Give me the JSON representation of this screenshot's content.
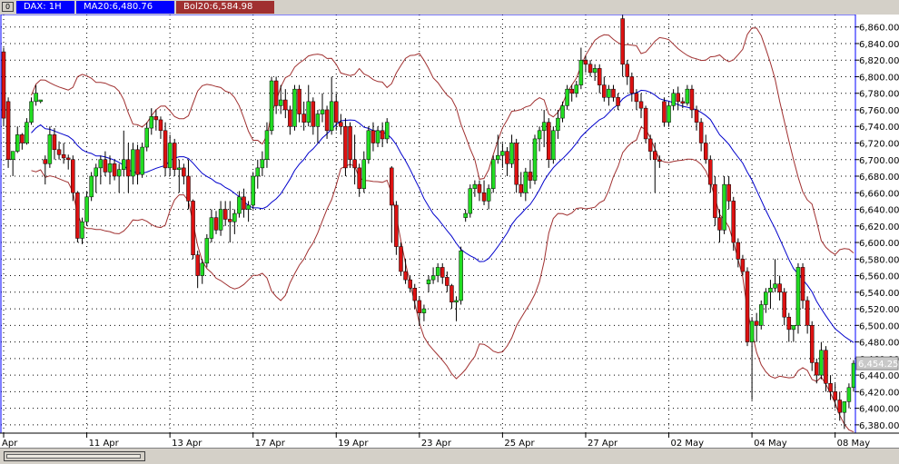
{
  "header": {
    "symbol_label": "DAX: 1H",
    "ma_label": "MA20:6,480.76",
    "bol_label": "Bol20:6,584.98"
  },
  "colors": {
    "up_candle": "#22dd22",
    "down_candle": "#dd1111",
    "ma_line": "#0000cc",
    "bollinger": "#a03030",
    "grid": "#000000",
    "last_price_box": "#c8c8c8"
  },
  "chart_data": {
    "type": "candlestick",
    "symbol": "DAX",
    "timeframe": "1H",
    "ylim": [
      6370,
      6875
    ],
    "y_ticks": [
      6380,
      6400,
      6420,
      6440,
      6460,
      6480,
      6500,
      6520,
      6540,
      6560,
      6580,
      6600,
      6620,
      6640,
      6660,
      6680,
      6700,
      6720,
      6740,
      6760,
      6780,
      6800,
      6820,
      6840,
      6860
    ],
    "y_tick_labels": [
      "6,380.00",
      "6,400.00",
      "6,420.00",
      "6,440.00",
      "6,460.00",
      "6,480.00",
      "6,500.00",
      "6,520.00",
      "6,540.00",
      "6,560.00",
      "6,580.00",
      "6,600.00",
      "6,620.00",
      "6,640.00",
      "6,660.00",
      "6,680.00",
      "6,700.00",
      "6,720.00",
      "6,740.00",
      "6,760.00",
      "6,780.00",
      "6,800.00",
      "6,820.00",
      "6,840.00",
      "6,860.00"
    ],
    "x_tick_labels": [
      "Apr",
      "11 Apr",
      "13 Apr",
      "17 Apr",
      "19 Apr",
      "23 Apr",
      "25 Apr",
      "27 Apr",
      "02 May",
      "04 May",
      "08 May"
    ],
    "x_tick_index": [
      0,
      18,
      36,
      54,
      72,
      90,
      108,
      126,
      144,
      162,
      180
    ],
    "last_price": 6454.25,
    "last_price_label": "6,454.25",
    "grid": true,
    "candles": [
      {
        "o": 6830,
        "h": 6835,
        "l": 6740,
        "c": 6750
      },
      {
        "o": 6770,
        "h": 6775,
        "l": 6690,
        "c": 6700
      },
      {
        "o": 6700,
        "h": 6705,
        "l": 6680,
        "c": 6710
      },
      {
        "o": 6710,
        "h": 6740,
        "l": 6708,
        "c": 6730
      },
      {
        "o": 6730,
        "h": 6732,
        "l": 6712,
        "c": 6720
      },
      {
        "o": 6720,
        "h": 6750,
        "l": 6718,
        "c": 6745
      },
      {
        "o": 6745,
        "h": 6775,
        "l": 6742,
        "c": 6770
      },
      {
        "o": 6770,
        "h": 6790,
        "l": 6765,
        "c": 6780
      },
      {
        "o": 6770,
        "h": 6772,
        "l": 6768,
        "c": 6772
      },
      {
        "o": 6700,
        "h": 6705,
        "l": 6670,
        "c": 6695
      },
      {
        "o": 6695,
        "h": 6740,
        "l": 6690,
        "c": 6730
      },
      {
        "o": 6730,
        "h": 6738,
        "l": 6700,
        "c": 6712
      },
      {
        "o": 6712,
        "h": 6722,
        "l": 6700,
        "c": 6706
      },
      {
        "o": 6706,
        "h": 6720,
        "l": 6695,
        "c": 6702
      },
      {
        "o": 6702,
        "h": 6706,
        "l": 6688,
        "c": 6700
      },
      {
        "o": 6700,
        "h": 6705,
        "l": 6650,
        "c": 6660
      },
      {
        "o": 6660,
        "h": 6662,
        "l": 6600,
        "c": 6605
      },
      {
        "o": 6605,
        "h": 6630,
        "l": 6598,
        "c": 6625
      },
      {
        "o": 6625,
        "h": 6662,
        "l": 6620,
        "c": 6655
      },
      {
        "o": 6655,
        "h": 6685,
        "l": 6650,
        "c": 6680
      },
      {
        "o": 6680,
        "h": 6695,
        "l": 6660,
        "c": 6690
      },
      {
        "o": 6690,
        "h": 6705,
        "l": 6670,
        "c": 6700
      },
      {
        "o": 6700,
        "h": 6710,
        "l": 6680,
        "c": 6685
      },
      {
        "o": 6685,
        "h": 6705,
        "l": 6670,
        "c": 6695
      },
      {
        "o": 6695,
        "h": 6700,
        "l": 6675,
        "c": 6680
      },
      {
        "o": 6680,
        "h": 6695,
        "l": 6660,
        "c": 6688
      },
      {
        "o": 6688,
        "h": 6735,
        "l": 6680,
        "c": 6700
      },
      {
        "o": 6700,
        "h": 6720,
        "l": 6660,
        "c": 6680
      },
      {
        "o": 6680,
        "h": 6720,
        "l": 6670,
        "c": 6712
      },
      {
        "o": 6712,
        "h": 6718,
        "l": 6670,
        "c": 6682
      },
      {
        "o": 6682,
        "h": 6720,
        "l": 6678,
        "c": 6715
      },
      {
        "o": 6715,
        "h": 6745,
        "l": 6710,
        "c": 6738
      },
      {
        "o": 6738,
        "h": 6762,
        "l": 6730,
        "c": 6752
      },
      {
        "o": 6752,
        "h": 6760,
        "l": 6735,
        "c": 6748
      },
      {
        "o": 6748,
        "h": 6752,
        "l": 6725,
        "c": 6735
      },
      {
        "o": 6735,
        "h": 6745,
        "l": 6680,
        "c": 6690
      },
      {
        "o": 6690,
        "h": 6730,
        "l": 6680,
        "c": 6720
      },
      {
        "o": 6720,
        "h": 6725,
        "l": 6680,
        "c": 6688
      },
      {
        "o": 6688,
        "h": 6700,
        "l": 6660,
        "c": 6690
      },
      {
        "o": 6690,
        "h": 6695,
        "l": 6670,
        "c": 6680
      },
      {
        "o": 6680,
        "h": 6700,
        "l": 6640,
        "c": 6650
      },
      {
        "o": 6650,
        "h": 6652,
        "l": 6580,
        "c": 6585
      },
      {
        "o": 6585,
        "h": 6590,
        "l": 6545,
        "c": 6560
      },
      {
        "o": 6560,
        "h": 6580,
        "l": 6550,
        "c": 6575
      },
      {
        "o": 6575,
        "h": 6610,
        "l": 6570,
        "c": 6605
      },
      {
        "o": 6605,
        "h": 6640,
        "l": 6600,
        "c": 6630
      },
      {
        "o": 6630,
        "h": 6638,
        "l": 6610,
        "c": 6615
      },
      {
        "o": 6615,
        "h": 6650,
        "l": 6608,
        "c": 6640
      },
      {
        "o": 6640,
        "h": 6650,
        "l": 6620,
        "c": 6628
      },
      {
        "o": 6628,
        "h": 6650,
        "l": 6600,
        "c": 6625
      },
      {
        "o": 6625,
        "h": 6640,
        "l": 6610,
        "c": 6635
      },
      {
        "o": 6635,
        "h": 6662,
        "l": 6630,
        "c": 6655
      },
      {
        "o": 6655,
        "h": 6665,
        "l": 6630,
        "c": 6640
      },
      {
        "o": 6640,
        "h": 6650,
        "l": 6625,
        "c": 6645
      },
      {
        "o": 6645,
        "h": 6685,
        "l": 6640,
        "c": 6680
      },
      {
        "o": 6680,
        "h": 6700,
        "l": 6665,
        "c": 6690
      },
      {
        "o": 6690,
        "h": 6710,
        "l": 6680,
        "c": 6700
      },
      {
        "o": 6700,
        "h": 6745,
        "l": 6690,
        "c": 6735
      },
      {
        "o": 6735,
        "h": 6800,
        "l": 6730,
        "c": 6795
      },
      {
        "o": 6795,
        "h": 6800,
        "l": 6755,
        "c": 6765
      },
      {
        "o": 6765,
        "h": 6790,
        "l": 6755,
        "c": 6772
      },
      {
        "o": 6772,
        "h": 6785,
        "l": 6750,
        "c": 6760
      },
      {
        "o": 6760,
        "h": 6765,
        "l": 6730,
        "c": 6740
      },
      {
        "o": 6740,
        "h": 6790,
        "l": 6735,
        "c": 6785
      },
      {
        "o": 6785,
        "h": 6790,
        "l": 6745,
        "c": 6755
      },
      {
        "o": 6755,
        "h": 6770,
        "l": 6735,
        "c": 6745
      },
      {
        "o": 6745,
        "h": 6790,
        "l": 6740,
        "c": 6770
      },
      {
        "o": 6770,
        "h": 6775,
        "l": 6730,
        "c": 6740
      },
      {
        "o": 6740,
        "h": 6760,
        "l": 6720,
        "c": 6755
      },
      {
        "o": 6755,
        "h": 6780,
        "l": 6745,
        "c": 6760
      },
      {
        "o": 6760,
        "h": 6765,
        "l": 6725,
        "c": 6735
      },
      {
        "o": 6735,
        "h": 6800,
        "l": 6730,
        "c": 6770
      },
      {
        "o": 6770,
        "h": 6780,
        "l": 6735,
        "c": 6745
      },
      {
        "o": 6745,
        "h": 6755,
        "l": 6730,
        "c": 6740
      },
      {
        "o": 6740,
        "h": 6750,
        "l": 6680,
        "c": 6690
      },
      {
        "o": 6740,
        "h": 6745,
        "l": 6690,
        "c": 6700
      },
      {
        "o": 6700,
        "h": 6730,
        "l": 6670,
        "c": 6690
      },
      {
        "o": 6690,
        "h": 6695,
        "l": 6655,
        "c": 6665
      },
      {
        "o": 6665,
        "h": 6710,
        "l": 6660,
        "c": 6700
      },
      {
        "o": 6700,
        "h": 6740,
        "l": 6695,
        "c": 6735
      },
      {
        "o": 6735,
        "h": 6745,
        "l": 6710,
        "c": 6720
      },
      {
        "o": 6720,
        "h": 6740,
        "l": 6715,
        "c": 6735
      },
      {
        "o": 6735,
        "h": 6745,
        "l": 6715,
        "c": 6725
      },
      {
        "o": 6725,
        "h": 6750,
        "l": 6720,
        "c": 6745
      },
      {
        "o": 6690,
        "h": 6692,
        "l": 6600,
        "c": 6645
      },
      {
        "o": 6645,
        "h": 6650,
        "l": 6585,
        "c": 6595
      },
      {
        "o": 6595,
        "h": 6600,
        "l": 6560,
        "c": 6565
      },
      {
        "o": 6565,
        "h": 6580,
        "l": 6550,
        "c": 6555
      },
      {
        "o": 6555,
        "h": 6560,
        "l": 6540,
        "c": 6545
      },
      {
        "o": 6545,
        "h": 6550,
        "l": 6520,
        "c": 6530
      },
      {
        "o": 6530,
        "h": 6535,
        "l": 6500,
        "c": 6515
      },
      {
        "o": 6515,
        "h": 6525,
        "l": 6505,
        "c": 6520
      },
      {
        "o": 6550,
        "h": 6560,
        "l": 6540,
        "c": 6555
      },
      {
        "o": 6555,
        "h": 6570,
        "l": 6550,
        "c": 6560
      },
      {
        "o": 6560,
        "h": 6575,
        "l": 6552,
        "c": 6570
      },
      {
        "o": 6570,
        "h": 6575,
        "l": 6550,
        "c": 6558
      },
      {
        "o": 6558,
        "h": 6565,
        "l": 6540,
        "c": 6548
      },
      {
        "o": 6548,
        "h": 6550,
        "l": 6520,
        "c": 6528
      },
      {
        "o": 6528,
        "h": 6535,
        "l": 6505,
        "c": 6530
      },
      {
        "o": 6530,
        "h": 6595,
        "l": 6525,
        "c": 6590
      },
      {
        "o": 6630,
        "h": 6640,
        "l": 6625,
        "c": 6635
      },
      {
        "o": 6635,
        "h": 6670,
        "l": 6630,
        "c": 6665
      },
      {
        "o": 6665,
        "h": 6675,
        "l": 6655,
        "c": 6670
      },
      {
        "o": 6670,
        "h": 6675,
        "l": 6650,
        "c": 6660
      },
      {
        "o": 6660,
        "h": 6675,
        "l": 6645,
        "c": 6650
      },
      {
        "o": 6650,
        "h": 6670,
        "l": 6640,
        "c": 6665
      },
      {
        "o": 6665,
        "h": 6705,
        "l": 6660,
        "c": 6700
      },
      {
        "o": 6700,
        "h": 6730,
        "l": 6695,
        "c": 6705
      },
      {
        "o": 6705,
        "h": 6720,
        "l": 6690,
        "c": 6710
      },
      {
        "o": 6710,
        "h": 6715,
        "l": 6680,
        "c": 6695
      },
      {
        "o": 6695,
        "h": 6730,
        "l": 6690,
        "c": 6720
      },
      {
        "o": 6720,
        "h": 6725,
        "l": 6660,
        "c": 6670
      },
      {
        "o": 6670,
        "h": 6685,
        "l": 6655,
        "c": 6660
      },
      {
        "o": 6660,
        "h": 6690,
        "l": 6650,
        "c": 6685
      },
      {
        "o": 6685,
        "h": 6700,
        "l": 6665,
        "c": 6675
      },
      {
        "o": 6675,
        "h": 6730,
        "l": 6670,
        "c": 6725
      },
      {
        "o": 6725,
        "h": 6740,
        "l": 6710,
        "c": 6735
      },
      {
        "o": 6735,
        "h": 6760,
        "l": 6715,
        "c": 6745
      },
      {
        "o": 6745,
        "h": 6750,
        "l": 6690,
        "c": 6700
      },
      {
        "o": 6700,
        "h": 6740,
        "l": 6695,
        "c": 6735
      },
      {
        "o": 6735,
        "h": 6760,
        "l": 6725,
        "c": 6750
      },
      {
        "o": 6750,
        "h": 6770,
        "l": 6745,
        "c": 6765
      },
      {
        "o": 6765,
        "h": 6790,
        "l": 6760,
        "c": 6785
      },
      {
        "o": 6785,
        "h": 6790,
        "l": 6770,
        "c": 6780
      },
      {
        "o": 6780,
        "h": 6795,
        "l": 6775,
        "c": 6790
      },
      {
        "o": 6790,
        "h": 6835,
        "l": 6785,
        "c": 6820
      },
      {
        "o": 6820,
        "h": 6825,
        "l": 6805,
        "c": 6815
      },
      {
        "o": 6815,
        "h": 6820,
        "l": 6800,
        "c": 6805
      },
      {
        "o": 6805,
        "h": 6815,
        "l": 6795,
        "c": 6810
      },
      {
        "o": 6810,
        "h": 6815,
        "l": 6780,
        "c": 6790
      },
      {
        "o": 6790,
        "h": 6800,
        "l": 6770,
        "c": 6775
      },
      {
        "o": 6775,
        "h": 6790,
        "l": 6765,
        "c": 6785
      },
      {
        "o": 6785,
        "h": 6790,
        "l": 6770,
        "c": 6775
      },
      {
        "o": 6775,
        "h": 6780,
        "l": 6760,
        "c": 6765
      },
      {
        "o": 6870,
        "h": 6880,
        "l": 6800,
        "c": 6815
      },
      {
        "o": 6815,
        "h": 6820,
        "l": 6790,
        "c": 6800
      },
      {
        "o": 6800,
        "h": 6805,
        "l": 6770,
        "c": 6780
      },
      {
        "o": 6780,
        "h": 6785,
        "l": 6760,
        "c": 6770
      },
      {
        "o": 6770,
        "h": 6780,
        "l": 6750,
        "c": 6762
      },
      {
        "o": 6762,
        "h": 6765,
        "l": 6720,
        "c": 6725
      },
      {
        "o": 6725,
        "h": 6730,
        "l": 6700,
        "c": 6710
      },
      {
        "o": 6710,
        "h": 6720,
        "l": 6660,
        "c": 6700
      },
      {
        "o": 6700,
        "h": 6705,
        "l": 6690,
        "c": 6698
      },
      {
        "o": 6770,
        "h": 6775,
        "l": 6740,
        "c": 6745
      },
      {
        "o": 6745,
        "h": 6770,
        "l": 6740,
        "c": 6765
      },
      {
        "o": 6765,
        "h": 6785,
        "l": 6760,
        "c": 6780
      },
      {
        "o": 6780,
        "h": 6788,
        "l": 6760,
        "c": 6770
      },
      {
        "o": 6770,
        "h": 6775,
        "l": 6762,
        "c": 6768
      },
      {
        "o": 6768,
        "h": 6790,
        "l": 6765,
        "c": 6785
      },
      {
        "o": 6785,
        "h": 6790,
        "l": 6750,
        "c": 6760
      },
      {
        "o": 6760,
        "h": 6765,
        "l": 6735,
        "c": 6745
      },
      {
        "o": 6745,
        "h": 6750,
        "l": 6710,
        "c": 6720
      },
      {
        "o": 6720,
        "h": 6730,
        "l": 6695,
        "c": 6700
      },
      {
        "o": 6700,
        "h": 6705,
        "l": 6660,
        "c": 6670
      },
      {
        "o": 6670,
        "h": 6680,
        "l": 6620,
        "c": 6630
      },
      {
        "o": 6630,
        "h": 6640,
        "l": 6600,
        "c": 6615
      },
      {
        "o": 6615,
        "h": 6680,
        "l": 6610,
        "c": 6670
      },
      {
        "o": 6670,
        "h": 6680,
        "l": 6640,
        "c": 6650
      },
      {
        "o": 6650,
        "h": 6655,
        "l": 6590,
        "c": 6600
      },
      {
        "o": 6600,
        "h": 6605,
        "l": 6570,
        "c": 6580
      },
      {
        "o": 6580,
        "h": 6585,
        "l": 6560,
        "c": 6565
      },
      {
        "o": 6565,
        "h": 6570,
        "l": 6475,
        "c": 6480
      },
      {
        "o": 6480,
        "h": 6510,
        "l": 6410,
        "c": 6505
      },
      {
        "o": 6505,
        "h": 6515,
        "l": 6480,
        "c": 6500
      },
      {
        "o": 6500,
        "h": 6530,
        "l": 6495,
        "c": 6525
      },
      {
        "o": 6525,
        "h": 6545,
        "l": 6515,
        "c": 6540
      },
      {
        "o": 6540,
        "h": 6555,
        "l": 6520,
        "c": 6545
      },
      {
        "o": 6545,
        "h": 6580,
        "l": 6540,
        "c": 6550
      },
      {
        "o": 6550,
        "h": 6560,
        "l": 6530,
        "c": 6540
      },
      {
        "o": 6540,
        "h": 6545,
        "l": 6500,
        "c": 6510
      },
      {
        "o": 6510,
        "h": 6515,
        "l": 6480,
        "c": 6495
      },
      {
        "o": 6495,
        "h": 6500,
        "l": 6480,
        "c": 6500
      },
      {
        "o": 6500,
        "h": 6575,
        "l": 6490,
        "c": 6570
      },
      {
        "o": 6570,
        "h": 6575,
        "l": 6520,
        "c": 6530
      },
      {
        "o": 6530,
        "h": 6535,
        "l": 6490,
        "c": 6500
      },
      {
        "o": 6500,
        "h": 6505,
        "l": 6445,
        "c": 6455
      },
      {
        "o": 6455,
        "h": 6460,
        "l": 6430,
        "c": 6440
      },
      {
        "o": 6440,
        "h": 6480,
        "l": 6435,
        "c": 6470
      },
      {
        "o": 6470,
        "h": 6475,
        "l": 6420,
        "c": 6430
      },
      {
        "o": 6430,
        "h": 6440,
        "l": 6410,
        "c": 6420
      },
      {
        "o": 6420,
        "h": 6430,
        "l": 6400,
        "c": 6410
      },
      {
        "o": 6410,
        "h": 6420,
        "l": 6385,
        "c": 6395
      },
      {
        "o": 6395,
        "h": 6400,
        "l": 6375,
        "c": 6408
      },
      {
        "o": 6408,
        "h": 6430,
        "l": 6400,
        "c": 6425
      },
      {
        "o": 6425,
        "h": 6458,
        "l": 6420,
        "c": 6454.25
      }
    ]
  }
}
